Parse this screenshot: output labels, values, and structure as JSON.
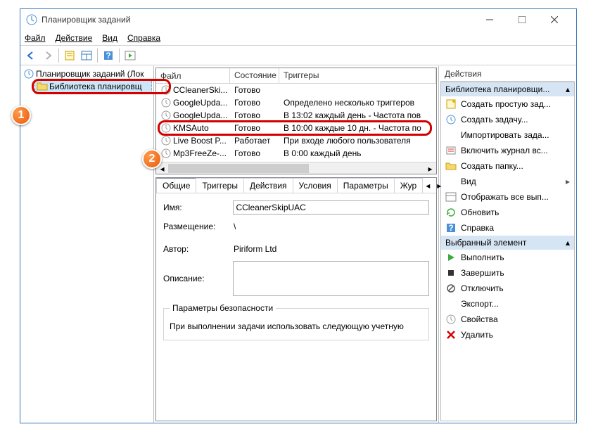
{
  "window": {
    "title": "Планировщик заданий"
  },
  "menubar": {
    "file": "Файл",
    "action": "Действие",
    "view": "Вид",
    "help": "Справка"
  },
  "tree": {
    "root": "Планировщик заданий (Лок",
    "library": "Библиотека планировщ"
  },
  "tasks": {
    "headers": {
      "file": "Файл",
      "state": "Состояние",
      "triggers": "Триггеры"
    },
    "rows": [
      {
        "file": "CCleanerSki...",
        "state": "Готово",
        "trig": ""
      },
      {
        "file": "GoogleUpda...",
        "state": "Готово",
        "trig": "Определено несколько триггеров"
      },
      {
        "file": "GoogleUpda...",
        "state": "Готово",
        "trig": "В 13:02 каждый день - Частота пов"
      },
      {
        "file": "KMSAuto",
        "state": "Готово",
        "trig": "В 10:00 каждые 10 дн. - Частота по"
      },
      {
        "file": "Live Boost P...",
        "state": "Работает",
        "trig": "При входе любого пользователя"
      },
      {
        "file": "Mp3FreeZe-...",
        "state": "Готово",
        "trig": "В 0:00 каждый день"
      }
    ]
  },
  "details": {
    "tabs": {
      "general": "Общие",
      "triggers": "Триггеры",
      "actions": "Действия",
      "conditions": "Условия",
      "settings": "Параметры",
      "journal": "Жур"
    },
    "labels": {
      "name": "Имя:",
      "location": "Размещение:",
      "author": "Автор:",
      "description": "Описание:"
    },
    "values": {
      "name": "CCleanerSkipUAC",
      "location": "\\",
      "author": "Piriform Ltd",
      "description": ""
    },
    "security": {
      "legend": "Параметры безопасности",
      "line": "При выполнении задачи использовать следующую учетную"
    }
  },
  "actions": {
    "header": "Действия",
    "group1": "Библиотека планировщи...",
    "items1": [
      "Создать простую зад...",
      "Создать задачу...",
      "Импортировать зада...",
      "Включить журнал вс...",
      "Создать папку..."
    ],
    "viewItem": "Вид",
    "items1b": [
      "Отображать все вып...",
      "Обновить",
      "Справка"
    ],
    "group2": "Выбранный элемент",
    "items2": [
      "Выполнить",
      "Завершить",
      "Отключить",
      "Экспорт...",
      "Свойства",
      "Удалить"
    ]
  },
  "callouts": {
    "n1": "1",
    "n2": "2"
  }
}
